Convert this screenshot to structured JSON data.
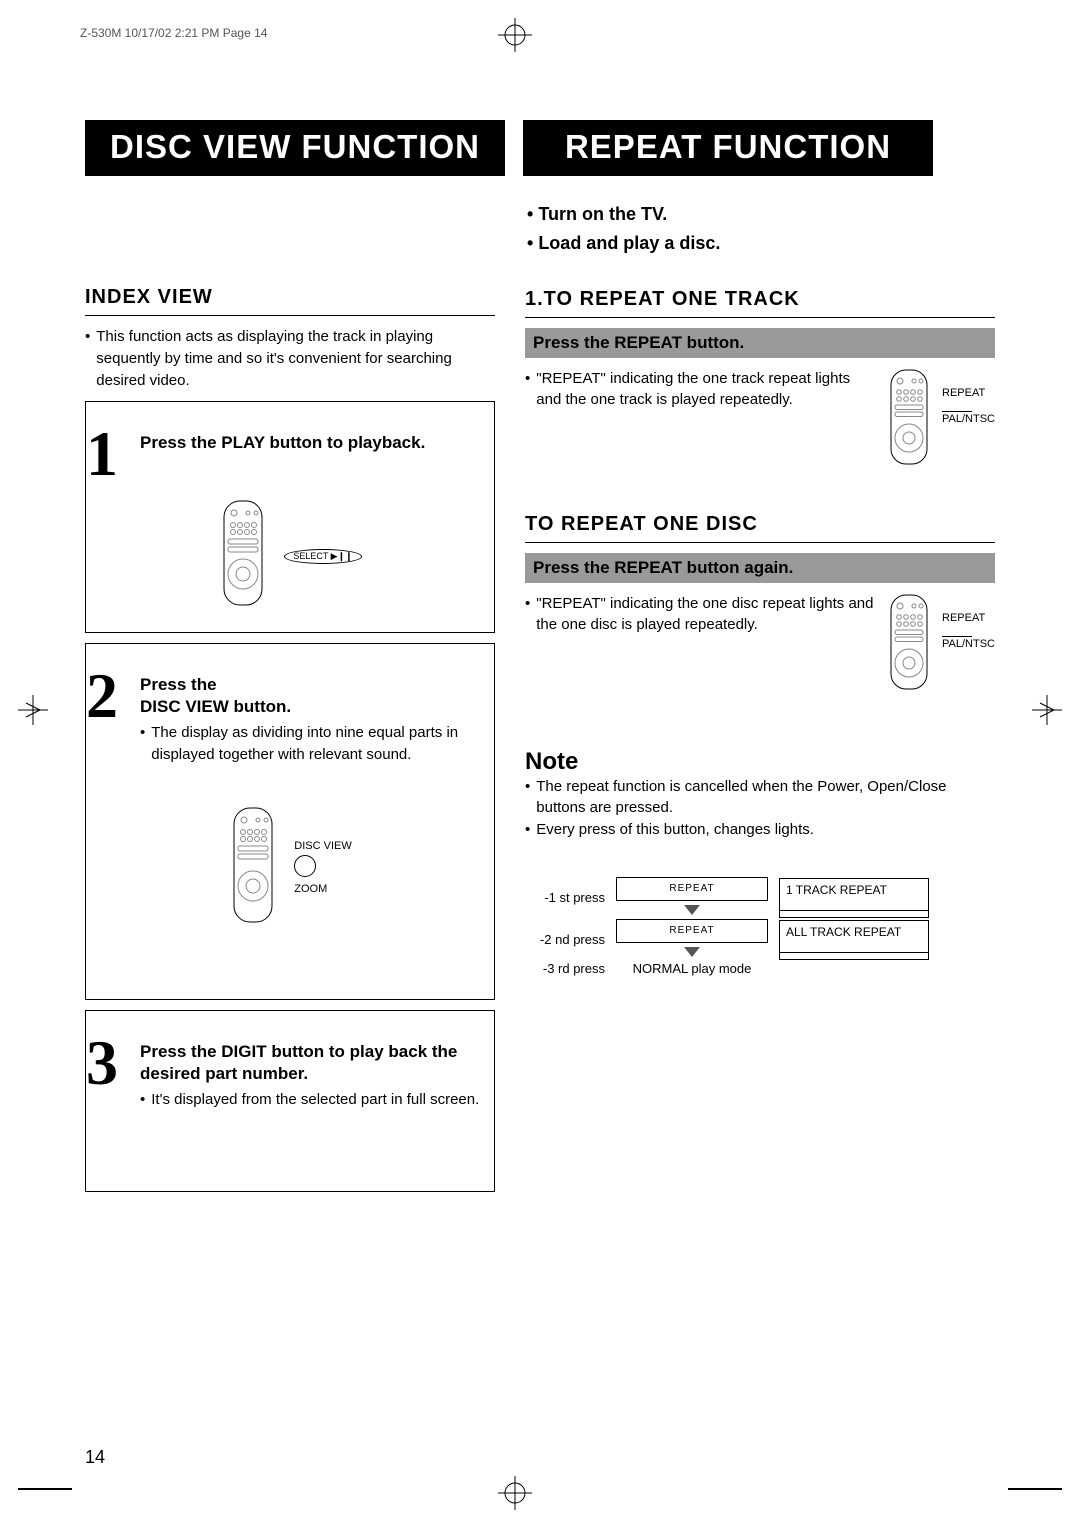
{
  "meta": {
    "doc_header": "Z-530M  10/17/02 2:21 PM  Page 14",
    "page_number": "14"
  },
  "titles": {
    "left": "DISC VIEW FUNCTION",
    "right": "REPEAT FUNCTION"
  },
  "left": {
    "index_heading": "INDEX VIEW",
    "index_desc": "This function acts as displaying the track in playing sequently by time and so it's convenient for searching desired video.",
    "step1_title": "Press the PLAY button to playback.",
    "step1_label": "SELECT ▶❙❙",
    "step2_title_a": "Press the",
    "step2_title_b": "DISC VIEW button.",
    "step2_desc": "The display as dividing into nine equal parts in displayed together with relevant sound.",
    "step2_label_a": "DISC VIEW",
    "step2_label_b": "ZOOM",
    "step3_title": "Press the DIGIT button to play back the desired part number.",
    "step3_desc": "It's displayed from the selected part in full screen."
  },
  "right": {
    "prep1": "Turn on the TV.",
    "prep2": "Load and play a disc.",
    "h1": "1.TO REPEAT ONE TRACK",
    "bar1": "Press the REPEAT button.",
    "desc1": "\"REPEAT\" indicating the one track repeat lights and the one track is played repeatedly.",
    "label_repeat": "REPEAT",
    "label_palntsc": "PAL/NTSC",
    "h2": "TO REPEAT ONE DISC",
    "bar2": "Press the REPEAT button again.",
    "desc2": "\"REPEAT\" indicating the one disc repeat lights and the one disc is played repeatedly.",
    "note_heading": "Note",
    "note1": "The repeat function is cancelled when the Power, Open/Close buttons are pressed.",
    "note2": "Every press of this button, changes lights.",
    "press1": "-1 st press",
    "press2": "-2 nd press",
    "press3": "-3 rd press",
    "repeat_caption": "REPEAT",
    "normal_caption": "NORMAL play mode",
    "disp1": "1 TRACK REPEAT",
    "disp2": "ALL TRACK REPEAT"
  }
}
